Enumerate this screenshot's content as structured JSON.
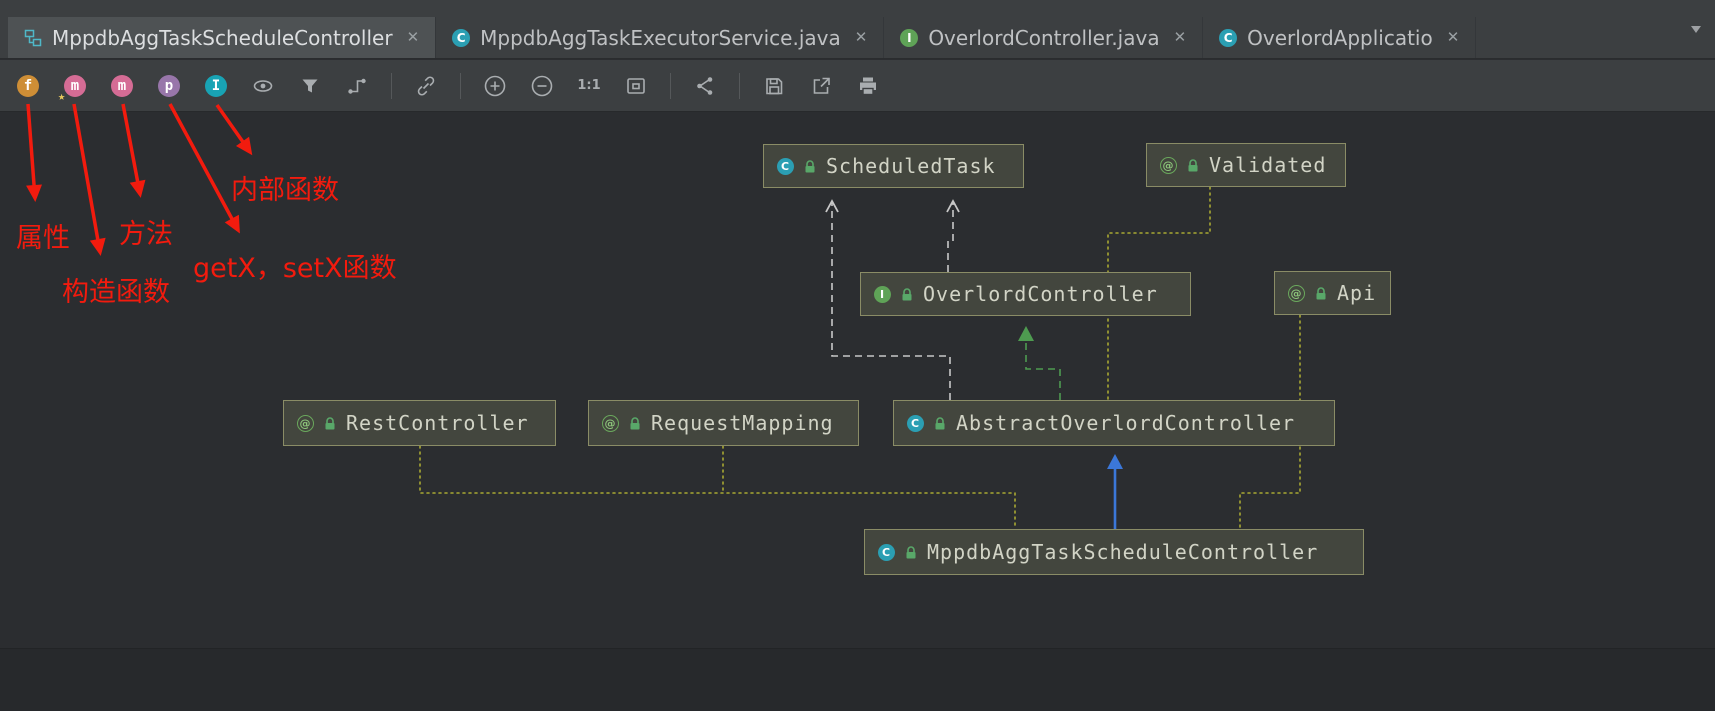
{
  "icons": {
    "close": "✕"
  },
  "tabs": [
    {
      "label": "MppdbAggTaskScheduleController",
      "icon": "uml-diagram",
      "active": true
    },
    {
      "label": "MppdbAggTaskExecutorService.java",
      "icon": "java-class",
      "icon_glyph": "C"
    },
    {
      "label": "OverlordController.java",
      "icon": "java-interface",
      "icon_glyph": "I"
    },
    {
      "label": "OverlordApplicatio",
      "icon": "java-application",
      "icon_glyph": "C"
    }
  ],
  "toolbar": {
    "star_glyph": "★",
    "buttons": [
      {
        "name": "fields",
        "glyph": "f"
      },
      {
        "name": "constructors",
        "glyph": "m"
      },
      {
        "name": "methods",
        "glyph": "m"
      },
      {
        "name": "properties",
        "glyph": "p"
      },
      {
        "name": "inner-classes",
        "glyph": "I"
      },
      {
        "name": "visibility"
      },
      {
        "name": "filter"
      },
      {
        "name": "edge-routing"
      },
      {
        "name": "link"
      },
      {
        "name": "zoom-in"
      },
      {
        "name": "zoom-out"
      },
      {
        "name": "actual-size",
        "glyph": "1:1"
      },
      {
        "name": "fit-content"
      },
      {
        "name": "apply-layout"
      },
      {
        "name": "save"
      },
      {
        "name": "export"
      },
      {
        "name": "print"
      }
    ]
  },
  "annotations": {
    "color": "#F21B0E",
    "labels": [
      {
        "text": "属性",
        "points_to": "fields-button"
      },
      {
        "text": "构造函数",
        "points_to": "constructors-button"
      },
      {
        "text": "方法",
        "points_to": "methods-button"
      },
      {
        "text": "内部函数",
        "points_to": "inner-classes-button"
      },
      {
        "text": "getX，setX函数",
        "points_to": "properties-button"
      }
    ]
  },
  "diagram": {
    "nodes": [
      {
        "label": "ScheduledTask",
        "kind": "class",
        "icon_glyph": "C"
      },
      {
        "label": "Validated",
        "kind": "annotation",
        "icon_glyph": "@"
      },
      {
        "label": "OverlordController",
        "kind": "interface",
        "icon_glyph": "I"
      },
      {
        "label": "Api",
        "kind": "annotation",
        "icon_glyph": "@"
      },
      {
        "label": "RestController",
        "kind": "annotation",
        "icon_glyph": "@"
      },
      {
        "label": "RequestMapping",
        "kind": "annotation",
        "icon_glyph": "@"
      },
      {
        "label": "AbstractOverlordController",
        "kind": "abstract-class",
        "icon_glyph": "C"
      },
      {
        "label": "MppdbAggTaskScheduleController",
        "kind": "class",
        "icon_glyph": "C"
      }
    ],
    "edges": [
      {
        "from": "OverlordController",
        "to": "ScheduledTask",
        "type": "implements"
      },
      {
        "from": "AbstractOverlordController",
        "to": "ScheduledTask",
        "type": "implements"
      },
      {
        "from": "AbstractOverlordController",
        "to": "OverlordController",
        "type": "implements"
      },
      {
        "from": "MppdbAggTaskScheduleController",
        "to": "AbstractOverlordController",
        "type": "extends"
      },
      {
        "from": "MppdbAggTaskScheduleController",
        "to": "RestController",
        "type": "annotation"
      },
      {
        "from": "MppdbAggTaskScheduleController",
        "to": "RequestMapping",
        "type": "annotation"
      },
      {
        "from": "AbstractOverlordController",
        "to": "Validated",
        "type": "annotation"
      },
      {
        "from": "MppdbAggTaskScheduleController",
        "to": "Api",
        "type": "annotation"
      }
    ]
  },
  "colors": {
    "background": "#2B2D30",
    "panel": "#3C3F41",
    "node_fill": "#43463E",
    "node_border": "#8A8C66",
    "extends_edge": "#3B77D8",
    "implements_edge": "#4E9B50",
    "realizes_edge": "#C8C8C8",
    "annotation_edge": "#A8A832",
    "annotation_red": "#F21B0E"
  }
}
